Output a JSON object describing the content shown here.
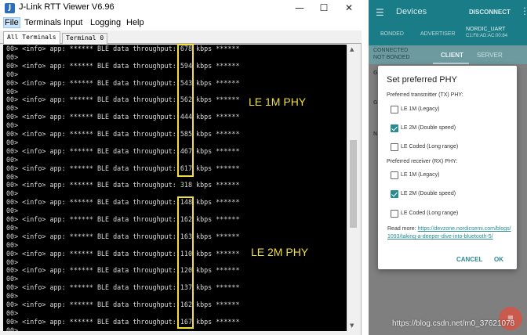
{
  "viewer": {
    "title": "J-Link RTT Viewer V6.96",
    "window_controls": {
      "minimize": "—",
      "maximize": "☐",
      "close": "✕"
    },
    "menu": [
      "File",
      "Terminals",
      "Input",
      "Logging",
      "Help"
    ],
    "tabs": [
      "All Terminals",
      "Terminal 0"
    ],
    "line_prefix": "00> ",
    "log_prefix": "00> <info> app: ****** BLE data throughput:",
    "log_unit": "kbps ******",
    "lines": [
      {
        "kind": "log",
        "value": "678"
      },
      {
        "kind": "blank"
      },
      {
        "kind": "log",
        "value": "594"
      },
      {
        "kind": "blank"
      },
      {
        "kind": "log",
        "value": "543"
      },
      {
        "kind": "blank"
      },
      {
        "kind": "log",
        "value": "562"
      },
      {
        "kind": "blank"
      },
      {
        "kind": "log",
        "value": "444"
      },
      {
        "kind": "blank"
      },
      {
        "kind": "log",
        "value": "585"
      },
      {
        "kind": "blank"
      },
      {
        "kind": "log",
        "value": "467"
      },
      {
        "kind": "blank"
      },
      {
        "kind": "log",
        "value": "617"
      },
      {
        "kind": "blank"
      },
      {
        "kind": "log",
        "value": "318"
      },
      {
        "kind": "blank"
      },
      {
        "kind": "log",
        "value": "148"
      },
      {
        "kind": "blank"
      },
      {
        "kind": "log",
        "value": "162"
      },
      {
        "kind": "blank"
      },
      {
        "kind": "log",
        "value": "163"
      },
      {
        "kind": "blank"
      },
      {
        "kind": "log",
        "value": "110"
      },
      {
        "kind": "blank"
      },
      {
        "kind": "log",
        "value": "120"
      },
      {
        "kind": "blank"
      },
      {
        "kind": "log",
        "value": "137"
      },
      {
        "kind": "blank"
      },
      {
        "kind": "log",
        "value": "162"
      },
      {
        "kind": "blank"
      },
      {
        "kind": "log",
        "value": "167"
      },
      {
        "kind": "blank"
      }
    ],
    "annotations": {
      "le1m": "LE 1M PHY",
      "le2m": "LE 2M PHY"
    },
    "highlight_color": "#f2df3a"
  },
  "phone": {
    "app_title": "Devices",
    "disconnect": "DISCONNECT",
    "tabs": {
      "bonded": "BONDED",
      "advertiser": "ADVERTISER"
    },
    "device_name": "NORDIC_UART",
    "device_mac": "C1:F8:AD:AC:00:84",
    "connection_state": [
      "CONNECTED",
      "NOT BONDED"
    ],
    "client_tab": "CLIENT",
    "server_tab": "SERVER",
    "background_letters": [
      "G",
      "G",
      "N"
    ],
    "accent": "#2a8a92",
    "appbar_color": "#1a7c87"
  },
  "dialog": {
    "title": "Set preferred PHY",
    "tx_heading": "Preferred transmitter (TX) PHY:",
    "rx_heading": "Preferred receiver (RX) PHY:",
    "tx_options": [
      {
        "label": "LE 1M (Legacy)",
        "checked": false
      },
      {
        "label": "LE 2M (Double speed)",
        "checked": true
      },
      {
        "label": "LE Coded (Long range)",
        "checked": false
      }
    ],
    "rx_options": [
      {
        "label": "LE 1M (Legacy)",
        "checked": false
      },
      {
        "label": "LE 2M (Double speed)",
        "checked": true
      },
      {
        "label": "LE Coded (Long range)",
        "checked": false
      }
    ],
    "read_more_label": "Read more: ",
    "read_more_link": "https://devzone.nordicsemi.com/blogs/1093/taking-a-deeper-dive-into-bluetooth-5/",
    "cancel": "CANCEL",
    "ok": "OK"
  },
  "watermark": "https://blog.csdn.net/m0_37621078"
}
